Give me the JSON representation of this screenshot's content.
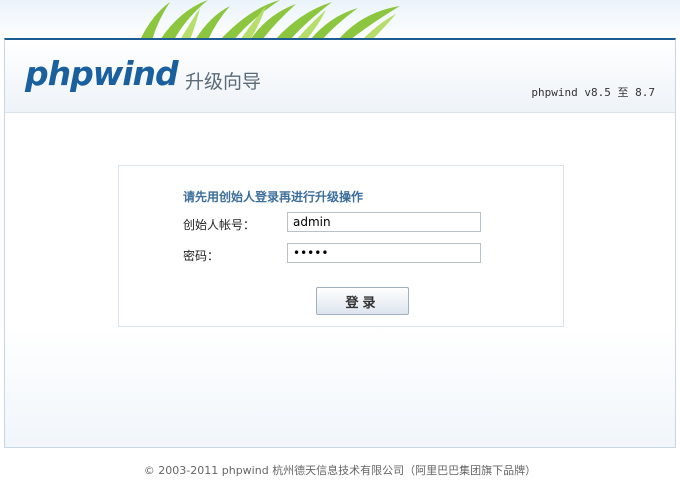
{
  "header": {
    "logo": "phpwind",
    "subtitle": "升级向导",
    "version": "phpwind v8.5 至 8.7"
  },
  "login": {
    "notice": "请先用创始人登录再进行升级操作",
    "account_label": "创始人帐号：",
    "account_value": "admin",
    "password_label": "密码：",
    "password_value": "admin",
    "submit_label": "登录"
  },
  "footer": {
    "copyright": "© 2003-2011 phpwind 杭州德天信息技术有限公司（阿里巴巴集团旗下品牌）"
  },
  "colors": {
    "brand": "#1a5f9e",
    "notice": "#3d6f9c",
    "frame_border": "#1d5d92"
  }
}
